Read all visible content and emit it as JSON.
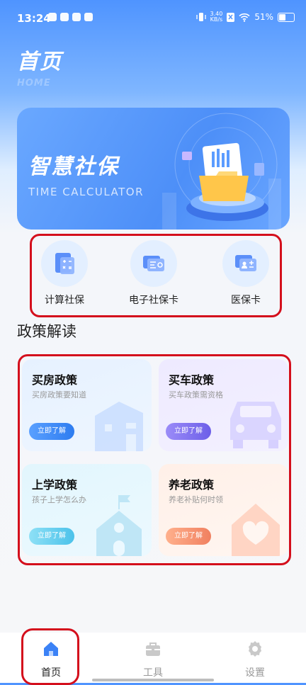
{
  "status_bar": {
    "time": "13:24",
    "net_speed_value": "3.40",
    "net_speed_unit": "KB/s",
    "battery": "51%"
  },
  "header": {
    "title": "首页",
    "subtitle": "HOME"
  },
  "banner": {
    "title": "智慧社保",
    "subtitle": "TIME CALCULATOR"
  },
  "shortcuts": [
    {
      "label": "计算社保",
      "icon": "calculator-icon"
    },
    {
      "label": "电子社保卡",
      "icon": "id-card-icon"
    },
    {
      "label": "医保卡",
      "icon": "medical-card-icon"
    }
  ],
  "section": {
    "title": "政策解读"
  },
  "policies": [
    {
      "title": "买房政策",
      "subtitle": "买房政策要知道",
      "button": "立即了解",
      "icon": "building-icon",
      "accent": "#3a8cf0"
    },
    {
      "title": "买车政策",
      "subtitle": "买车政策需资格",
      "button": "立即了解",
      "icon": "car-icon",
      "accent": "#7b6ef0"
    },
    {
      "title": "上学政策",
      "subtitle": "孩子上学怎么办",
      "button": "立即了解",
      "icon": "school-icon",
      "accent": "#5cc7ec"
    },
    {
      "title": "养老政策",
      "subtitle": "养老补贴何时领",
      "button": "立即了解",
      "icon": "heart-house-icon",
      "accent": "#f08a63"
    }
  ],
  "tabs": [
    {
      "label": "首页",
      "icon": "home-icon",
      "active": true
    },
    {
      "label": "工具",
      "icon": "toolbox-icon",
      "active": false
    },
    {
      "label": "设置",
      "icon": "gear-icon",
      "active": false
    }
  ],
  "colors": {
    "primary": "#3b82f6",
    "highlight": "#d40f1c"
  }
}
